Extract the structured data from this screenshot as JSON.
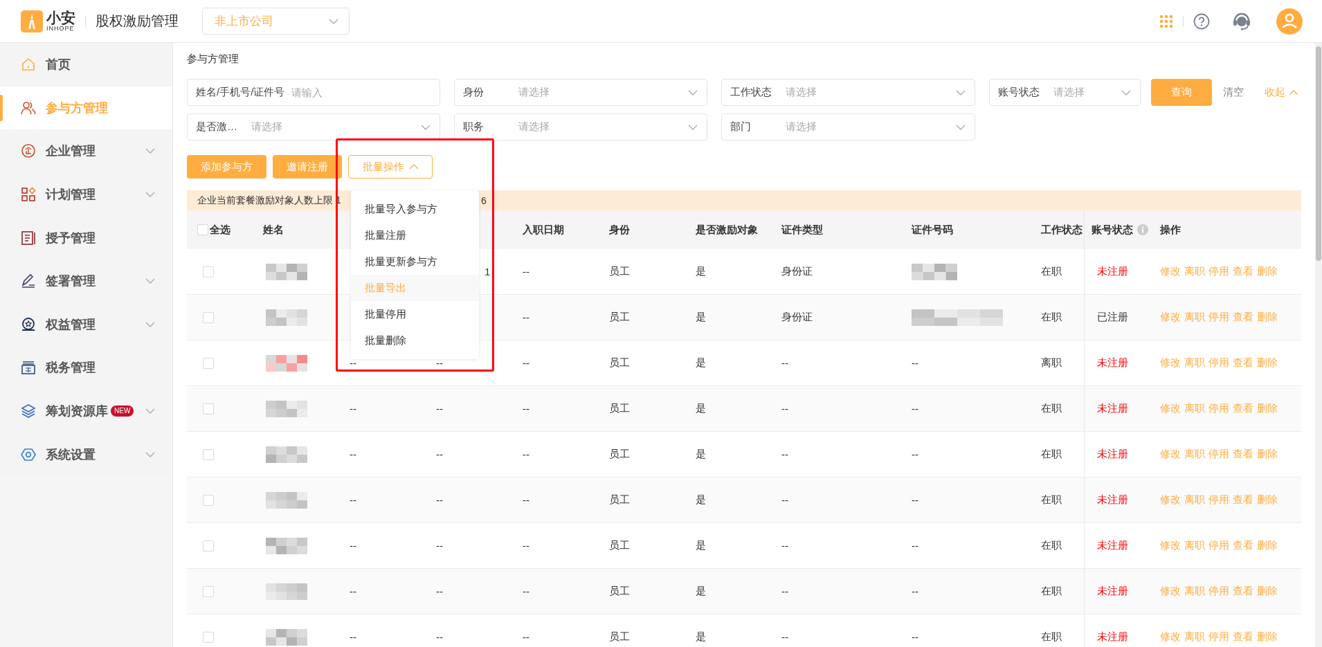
{
  "header": {
    "logo_text": "小安",
    "logo_subtext": "INHOPE",
    "app_title": "股权激励管理",
    "company_select": "非上市公司"
  },
  "sidebar": {
    "items": [
      {
        "label": "首页",
        "selected": false
      },
      {
        "label": "参与方管理",
        "selected": true
      },
      {
        "label": "企业管理",
        "selected": false,
        "expanded": false
      },
      {
        "label": "计划管理",
        "selected": false,
        "expanded": false
      },
      {
        "label": "授予管理",
        "selected": false
      },
      {
        "label": "签署管理",
        "selected": false,
        "expanded": false
      },
      {
        "label": "权益管理",
        "selected": false,
        "expanded": false
      },
      {
        "label": "税务管理",
        "selected": false
      },
      {
        "label": "筹划资源库",
        "selected": false,
        "expanded": false,
        "badge": "NEW"
      },
      {
        "label": "系统设置",
        "selected": false,
        "expanded": false
      }
    ]
  },
  "page_title": "参与方管理",
  "filters": [
    {
      "kind": "input",
      "label": "姓名/手机号/证件号",
      "placeholder": "请输入"
    },
    {
      "kind": "select",
      "label": "身份",
      "placeholder": "请选择"
    },
    {
      "kind": "select",
      "label": "工作状态",
      "placeholder": "请选择"
    },
    {
      "kind": "select",
      "label": "账号状态",
      "placeholder": "请选择"
    },
    {
      "kind": "select",
      "label": "是否激…",
      "placeholder": "请选择"
    },
    {
      "kind": "select",
      "label": "职务",
      "placeholder": "请选择"
    },
    {
      "kind": "select",
      "label": "部门",
      "placeholder": "请选择"
    }
  ],
  "filter_actions": {
    "query": "查询",
    "clear": "清空",
    "collapse": "收起"
  },
  "toolbar": {
    "buttons": [
      "添加参与方",
      "邀请注册"
    ],
    "batch": {
      "label": "批量操作",
      "open": true
    }
  },
  "batch_menu": [
    {
      "label": "批量导入参与方",
      "selected": false
    },
    {
      "label": "批量注册",
      "selected": false
    },
    {
      "label": "批量更新参与方",
      "selected": false
    },
    {
      "label": "批量导出",
      "selected": true
    },
    {
      "label": "批量停用",
      "selected": false
    },
    {
      "label": "批量删除",
      "selected": false
    }
  ],
  "highlight_frame": {
    "shown": true
  },
  "banner": {
    "text_start": "企业当前套餐激励对象人数上限 1",
    "text_end": "6"
  },
  "table": {
    "select_all": {
      "label": "全选",
      "checked": false
    },
    "columns": {
      "name": "姓名",
      "join_date": "入职日期",
      "identity": "身份",
      "incentive": "是否激励对象",
      "id_type": "证件类型",
      "id_number": "证件号码",
      "work_status": "工作状态",
      "account_status": "账号状态",
      "actions": "操作"
    },
    "rows": [
      {
        "checked": false,
        "name": {
          "kind": "picture"
        },
        "column_4": {
          "text": "1",
          "clipped": true
        },
        "join_date": "--",
        "identity": "员工",
        "incentive": "是",
        "id_type": "身份证",
        "id_number": {
          "kind": "picture"
        },
        "work_status": "在职",
        "account_status": {
          "text": "未注册",
          "registered": false
        },
        "actions": [
          "修改",
          "离职",
          "停用",
          "查看",
          "删除"
        ]
      },
      {
        "checked": false,
        "name": {
          "kind": "picture"
        },
        "join_date": "--",
        "identity": "员工",
        "incentive": "是",
        "id_type": "身份证",
        "id_number": {
          "kind": "picture"
        },
        "work_status": "在职",
        "account_status": {
          "text": "已注册",
          "registered": true
        },
        "actions": [
          "修改",
          "离职",
          "停用",
          "查看",
          "删除"
        ]
      },
      {
        "checked": false,
        "name": {
          "kind": "picture"
        },
        "column_3": "--",
        "column_4": "--",
        "join_date": "--",
        "identity": "员工",
        "incentive": "是",
        "id_type": "--",
        "id_number": "--",
        "work_status": "离职",
        "account_status": {
          "text": "未注册",
          "registered": false
        },
        "actions": [
          "修改",
          "离职",
          "停用",
          "查看",
          "删除"
        ]
      },
      {
        "checked": false,
        "name": {
          "kind": "picture"
        },
        "column_3": "--",
        "column_4": "--",
        "join_date": "--",
        "identity": "员工",
        "incentive": "是",
        "id_type": "--",
        "id_number": "--",
        "work_status": "在职",
        "account_status": {
          "text": "未注册",
          "registered": false
        },
        "actions": [
          "修改",
          "离职",
          "停用",
          "查看",
          "删除"
        ]
      },
      {
        "checked": false,
        "name": {
          "kind": "picture"
        },
        "column_3": "--",
        "column_4": "--",
        "join_date": "--",
        "identity": "员工",
        "incentive": "是",
        "id_type": "--",
        "id_number": "--",
        "work_status": "在职",
        "account_status": {
          "text": "未注册",
          "registered": false
        },
        "actions": [
          "修改",
          "离职",
          "停用",
          "查看",
          "删除"
        ]
      },
      {
        "checked": false,
        "name": {
          "kind": "picture"
        },
        "column_3": "--",
        "column_4": "--",
        "join_date": "--",
        "identity": "员工",
        "incentive": "是",
        "id_type": "--",
        "id_number": "--",
        "work_status": "在职",
        "account_status": {
          "text": "未注册",
          "registered": false
        },
        "actions": [
          "修改",
          "离职",
          "停用",
          "查看",
          "删除"
        ]
      },
      {
        "checked": false,
        "name": {
          "kind": "picture"
        },
        "column_3": "--",
        "column_4": "--",
        "join_date": "--",
        "identity": "员工",
        "incentive": "是",
        "id_type": "--",
        "id_number": "--",
        "work_status": "在职",
        "account_status": {
          "text": "未注册",
          "registered": false
        },
        "actions": [
          "修改",
          "离职",
          "停用",
          "查看",
          "删除"
        ]
      },
      {
        "checked": false,
        "name": {
          "kind": "picture"
        },
        "column_3": "--",
        "column_4": "--",
        "join_date": "--",
        "identity": "员工",
        "incentive": "是",
        "id_type": "--",
        "id_number": "--",
        "work_status": "在职",
        "account_status": {
          "text": "未注册",
          "registered": false
        },
        "actions": [
          "修改",
          "离职",
          "停用",
          "查看",
          "删除"
        ]
      },
      {
        "checked": false,
        "name": {
          "kind": "picture"
        },
        "column_3": "--",
        "column_4": "--",
        "join_date": "--",
        "identity": "员工",
        "incentive": "是",
        "id_type": "--",
        "id_number": "--",
        "work_status": "在职",
        "account_status": {
          "text": "未注册",
          "registered": false
        },
        "actions": [
          "修改",
          "离职",
          "停用",
          "查看",
          "删除"
        ]
      }
    ]
  }
}
